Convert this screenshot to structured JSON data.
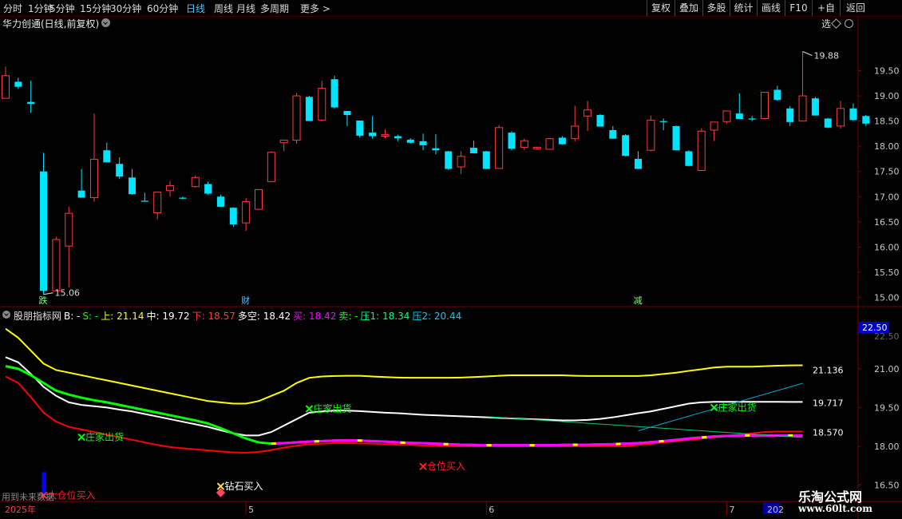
{
  "toolbar": {
    "periods": [
      "分时",
      "1分钟",
      "5分钟",
      "15分钟",
      "30分钟",
      "60分钟",
      "日线",
      "周线",
      "月线",
      "多周期",
      "更多 >"
    ],
    "active_period": "日线",
    "right_buttons": [
      "复权",
      "叠加",
      "多股",
      "统计",
      "画线",
      "F10",
      "+自选",
      "返回"
    ]
  },
  "chart_title": "华力创通(日线,前复权)",
  "colors": {
    "up": "#ff3b3b",
    "down": "#00e5ff",
    "upper_band": "#ffff00",
    "middle_band": "#ffffff",
    "lower_band": "#ff0000",
    "long_short": "#00ff00",
    "buy": "#ff00ff",
    "ma_line": "#00cc66",
    "axis": "#7a0000",
    "tick_text": "#c8c8c8"
  },
  "chart_data": [
    {
      "type": "candlestick",
      "title": "华力创通(日线,前复权)",
      "ylim": [
        14.85,
        20.3
      ],
      "y_ticks": [
        15.0,
        15.5,
        16.0,
        16.5,
        17.0,
        17.5,
        18.0,
        18.5,
        19.0,
        19.5
      ],
      "y_tick_labels": [
        "15.00",
        "15.50",
        "16.00",
        "16.50",
        "17.00",
        "17.50",
        "18.00",
        "18.50",
        "19.00",
        "19.50"
      ],
      "candles": [
        {
          "o": 18.95,
          "h": 19.58,
          "l": 18.95,
          "c": 19.4
        },
        {
          "o": 19.28,
          "h": 19.36,
          "l": 19.14,
          "c": 19.18
        },
        {
          "o": 18.88,
          "h": 19.3,
          "l": 18.66,
          "c": 18.84
        },
        {
          "o": 17.5,
          "h": 17.87,
          "l": 15.06,
          "c": 15.13
        },
        {
          "o": 15.13,
          "h": 16.2,
          "l": 15.13,
          "c": 16.15
        },
        {
          "o": 16.02,
          "h": 16.8,
          "l": 15.2,
          "c": 16.67
        },
        {
          "o": 17.12,
          "h": 17.55,
          "l": 17.1,
          "c": 16.98
        },
        {
          "o": 16.98,
          "h": 18.65,
          "l": 16.9,
          "c": 17.74
        },
        {
          "o": 17.92,
          "h": 18.07,
          "l": 17.72,
          "c": 17.68
        },
        {
          "o": 17.65,
          "h": 17.78,
          "l": 17.35,
          "c": 17.4
        },
        {
          "o": 17.38,
          "h": 17.55,
          "l": 17.04,
          "c": 17.05
        },
        {
          "o": 16.92,
          "h": 17.08,
          "l": 16.9,
          "c": 16.9
        },
        {
          "o": 16.68,
          "h": 17.06,
          "l": 16.55,
          "c": 17.09
        },
        {
          "o": 17.12,
          "h": 17.31,
          "l": 17.0,
          "c": 17.22
        },
        {
          "o": 16.98,
          "h": 17.0,
          "l": 16.95,
          "c": 16.96
        },
        {
          "o": 17.2,
          "h": 17.42,
          "l": 17.18,
          "c": 17.38
        },
        {
          "o": 17.25,
          "h": 17.3,
          "l": 17.04,
          "c": 17.06
        },
        {
          "o": 17.0,
          "h": 17.04,
          "l": 16.82,
          "c": 16.8
        },
        {
          "o": 16.78,
          "h": 16.79,
          "l": 16.4,
          "c": 16.45
        },
        {
          "o": 16.48,
          "h": 16.97,
          "l": 16.32,
          "c": 16.9
        },
        {
          "o": 16.75,
          "h": 17.15,
          "l": 16.74,
          "c": 17.14
        },
        {
          "o": 17.3,
          "h": 17.9,
          "l": 17.3,
          "c": 17.88
        },
        {
          "o": 18.07,
          "h": 18.13,
          "l": 17.9,
          "c": 18.12
        },
        {
          "o": 18.12,
          "h": 19.06,
          "l": 18.05,
          "c": 19.0
        },
        {
          "o": 18.98,
          "h": 19.0,
          "l": 18.52,
          "c": 18.5
        },
        {
          "o": 18.52,
          "h": 19.3,
          "l": 18.5,
          "c": 19.15
        },
        {
          "o": 19.33,
          "h": 19.4,
          "l": 18.75,
          "c": 18.77
        },
        {
          "o": 18.7,
          "h": 18.7,
          "l": 18.4,
          "c": 18.62
        },
        {
          "o": 18.51,
          "h": 18.51,
          "l": 18.17,
          "c": 18.21
        },
        {
          "o": 18.27,
          "h": 18.6,
          "l": 18.15,
          "c": 18.2
        },
        {
          "o": 18.2,
          "h": 18.34,
          "l": 18.16,
          "c": 18.23
        },
        {
          "o": 18.2,
          "h": 18.23,
          "l": 18.1,
          "c": 18.16
        },
        {
          "o": 18.13,
          "h": 18.16,
          "l": 18.05,
          "c": 18.07
        },
        {
          "o": 18.1,
          "h": 18.25,
          "l": 17.92,
          "c": 18.02
        },
        {
          "o": 17.96,
          "h": 18.24,
          "l": 17.84,
          "c": 17.92
        },
        {
          "o": 17.9,
          "h": 17.91,
          "l": 17.53,
          "c": 17.55
        },
        {
          "o": 17.59,
          "h": 17.9,
          "l": 17.45,
          "c": 17.8
        },
        {
          "o": 17.97,
          "h": 18.11,
          "l": 17.87,
          "c": 17.86
        },
        {
          "o": 17.9,
          "h": 17.91,
          "l": 17.55,
          "c": 17.55
        },
        {
          "o": 17.56,
          "h": 18.42,
          "l": 17.55,
          "c": 18.37
        },
        {
          "o": 18.27,
          "h": 18.3,
          "l": 17.92,
          "c": 17.95
        },
        {
          "o": 17.98,
          "h": 18.15,
          "l": 17.92,
          "c": 18.11
        },
        {
          "o": 17.95,
          "h": 17.99,
          "l": 17.94,
          "c": 17.98
        },
        {
          "o": 17.94,
          "h": 18.16,
          "l": 17.93,
          "c": 18.15
        },
        {
          "o": 18.17,
          "h": 18.2,
          "l": 18.03,
          "c": 18.04
        },
        {
          "o": 18.15,
          "h": 18.8,
          "l": 18.1,
          "c": 18.4
        },
        {
          "o": 18.6,
          "h": 18.9,
          "l": 18.3,
          "c": 18.72
        },
        {
          "o": 18.62,
          "h": 18.64,
          "l": 18.41,
          "c": 18.39
        },
        {
          "o": 18.32,
          "h": 18.4,
          "l": 18.15,
          "c": 18.15
        },
        {
          "o": 18.22,
          "h": 18.24,
          "l": 17.8,
          "c": 17.81
        },
        {
          "o": 17.75,
          "h": 17.9,
          "l": 17.55,
          "c": 17.55
        },
        {
          "o": 17.92,
          "h": 18.61,
          "l": 17.9,
          "c": 18.52
        },
        {
          "o": 18.5,
          "h": 18.55,
          "l": 18.32,
          "c": 18.48
        },
        {
          "o": 18.4,
          "h": 18.41,
          "l": 17.95,
          "c": 17.92
        },
        {
          "o": 17.9,
          "h": 17.92,
          "l": 17.6,
          "c": 17.61
        },
        {
          "o": 17.52,
          "h": 18.35,
          "l": 17.52,
          "c": 18.3
        },
        {
          "o": 18.32,
          "h": 18.47,
          "l": 18.1,
          "c": 18.48
        },
        {
          "o": 18.49,
          "h": 18.7,
          "l": 18.45,
          "c": 18.7
        },
        {
          "o": 18.65,
          "h": 19.05,
          "l": 18.55,
          "c": 18.54
        },
        {
          "o": 18.55,
          "h": 18.6,
          "l": 18.5,
          "c": 18.53
        },
        {
          "o": 18.55,
          "h": 19.08,
          "l": 18.55,
          "c": 19.07
        },
        {
          "o": 19.12,
          "h": 19.2,
          "l": 18.9,
          "c": 18.92
        },
        {
          "o": 18.75,
          "h": 18.8,
          "l": 18.4,
          "c": 18.48
        },
        {
          "o": 18.5,
          "h": 19.88,
          "l": 18.5,
          "c": 19.0
        },
        {
          "o": 18.95,
          "h": 18.98,
          "l": 18.65,
          "c": 18.61
        },
        {
          "o": 18.55,
          "h": 18.56,
          "l": 18.36,
          "c": 18.37
        },
        {
          "o": 18.4,
          "h": 18.9,
          "l": 18.35,
          "c": 18.75
        },
        {
          "o": 18.75,
          "h": 18.85,
          "l": 18.5,
          "c": 18.52
        },
        {
          "o": 18.6,
          "h": 18.62,
          "l": 18.4,
          "c": 18.45
        }
      ],
      "high_label": "19.88",
      "low_label": "15.06",
      "event_markers": [
        {
          "index": 3,
          "label": "跌"
        },
        {
          "index": 19,
          "label": "财"
        },
        {
          "index": 50,
          "label": "减"
        }
      ]
    },
    {
      "type": "line",
      "title": "股朋指标网",
      "ylim": [
        16.05,
        22.85
      ],
      "y_ticks": [
        16.5,
        18.0,
        19.5,
        21.0
      ],
      "y_tick_labels": [
        "16.50",
        "18.00",
        "19.50",
        "21.00"
      ],
      "current_value_box": "22.50",
      "top_partial_label": "22.50",
      "legend": [
        {
          "key": "B",
          "text": "B: -"
        },
        {
          "key": "S",
          "text": "S: -"
        },
        {
          "key": "upper",
          "text": "上: 21.14"
        },
        {
          "key": "middle",
          "text": "中: 19.72"
        },
        {
          "key": "lower",
          "text": "下: 18.57"
        },
        {
          "key": "long_short",
          "text": "多空: 18.42"
        },
        {
          "key": "buy",
          "text": "买: 18.42"
        },
        {
          "key": "sell",
          "text": "卖: -"
        },
        {
          "key": "p1",
          "text": "压1: 18.34"
        },
        {
          "key": "p2",
          "text": "压2: 20.44"
        }
      ],
      "series": [
        {
          "key": "upper",
          "values": [
            22.55,
            22.2,
            21.7,
            21.2,
            20.95,
            20.85,
            20.75,
            20.65,
            20.55,
            20.45,
            20.35,
            20.25,
            20.15,
            20.05,
            19.95,
            19.85,
            19.75,
            19.7,
            19.65,
            19.65,
            19.75,
            19.95,
            20.15,
            20.45,
            20.65,
            20.7,
            20.72,
            20.73,
            20.73,
            20.7,
            20.68,
            20.66,
            20.65,
            20.65,
            20.65,
            20.65,
            20.66,
            20.68,
            20.7,
            20.73,
            20.75,
            20.75,
            20.75,
            20.75,
            20.75,
            20.73,
            20.72,
            20.72,
            20.72,
            20.72,
            20.72,
            20.75,
            20.8,
            20.85,
            20.92,
            20.98,
            21.05,
            21.08,
            21.08,
            21.08,
            21.1,
            21.12,
            21.13,
            21.136
          ]
        },
        {
          "key": "middle",
          "values": [
            21.45,
            21.25,
            20.8,
            20.3,
            19.95,
            19.7,
            19.6,
            19.55,
            19.5,
            19.42,
            19.35,
            19.25,
            19.15,
            19.05,
            18.95,
            18.85,
            18.75,
            18.62,
            18.5,
            18.42,
            18.42,
            18.55,
            18.8,
            19.05,
            19.3,
            19.35,
            19.38,
            19.38,
            19.36,
            19.33,
            19.3,
            19.28,
            19.25,
            19.22,
            19.2,
            19.18,
            19.16,
            19.14,
            19.12,
            19.1,
            19.08,
            19.06,
            19.04,
            19.02,
            19.0,
            19.0,
            19.02,
            19.06,
            19.12,
            19.2,
            19.28,
            19.35,
            19.45,
            19.55,
            19.65,
            19.7,
            19.72,
            19.72,
            19.72,
            19.72,
            19.72,
            19.72,
            19.717,
            19.717
          ]
        },
        {
          "key": "lower",
          "values": [
            20.7,
            20.45,
            19.9,
            19.3,
            18.95,
            18.75,
            18.65,
            18.55,
            18.45,
            18.35,
            18.25,
            18.15,
            18.05,
            17.97,
            17.92,
            17.88,
            17.84,
            17.8,
            17.76,
            17.75,
            17.78,
            17.85,
            17.95,
            18.02,
            18.08,
            18.1,
            18.12,
            18.12,
            18.11,
            18.1,
            18.08,
            18.06,
            18.05,
            18.03,
            18.02,
            18.0,
            18.0,
            18.0,
            18.0,
            18.0,
            18.0,
            18.0,
            18.0,
            18.0,
            18.0,
            18.0,
            18.0,
            18.0,
            18.0,
            18.0,
            18.05,
            18.1,
            18.15,
            18.2,
            18.25,
            18.3,
            18.35,
            18.4,
            18.45,
            18.5,
            18.55,
            18.57,
            18.57,
            18.57
          ]
        },
        {
          "key": "long_short",
          "values": [
            21.1,
            21.0,
            20.75,
            20.45,
            20.15,
            20.0,
            19.88,
            19.78,
            19.7,
            19.6,
            19.5,
            19.4,
            19.3,
            19.2,
            19.1,
            19.0,
            18.88,
            18.7,
            18.5,
            18.3,
            18.15,
            18.1,
            18.12,
            18.15,
            18.18,
            18.2,
            18.22,
            18.23,
            18.22,
            18.2,
            18.18,
            18.15,
            18.13,
            18.12,
            18.1,
            18.08,
            18.06,
            18.05,
            18.04,
            18.04,
            18.04,
            18.04,
            18.04,
            18.04,
            18.05,
            18.06,
            18.06,
            18.07,
            18.08,
            18.1,
            18.12,
            18.16,
            18.2,
            18.25,
            18.3,
            18.34,
            18.38,
            18.4,
            18.41,
            18.42,
            18.42,
            18.42,
            18.42,
            18.42
          ]
        }
      ],
      "buy_segment": {
        "from_index": 21,
        "to_index": 63
      },
      "p1_line": {
        "from_index": 38,
        "from_value": 19.15,
        "to_index": 63,
        "to_value": 18.34
      },
      "p2_line": {
        "from_index": 50,
        "from_value": 18.6,
        "to_index": 63,
        "to_value": 20.44
      },
      "right_labels": [
        {
          "series": "upper",
          "text": "21.136"
        },
        {
          "series": "middle",
          "text": "19.717"
        },
        {
          "series": "lower",
          "text": "18.570"
        }
      ],
      "annotations": [
        {
          "index": 6,
          "value": 18.35,
          "text": "庄家出货",
          "color": "#00ff00",
          "mark": "x"
        },
        {
          "index": 24,
          "value": 19.45,
          "text": "庄家出货",
          "color": "#00ff00",
          "mark": "x"
        },
        {
          "index": 56,
          "value": 19.5,
          "text": "庄家出货",
          "color": "#00ff00",
          "mark": "x"
        },
        {
          "index": 33,
          "value": 17.22,
          "text": "仓位买入",
          "color": "#ff2020",
          "mark": "x"
        },
        {
          "index": 17,
          "value": 16.45,
          "text": "钻石买入",
          "color": "#ffffff",
          "mark": "x"
        },
        {
          "index": 3,
          "value": 16.1,
          "text": "大仓位买入",
          "color": "#ff2020",
          "mark": "x"
        }
      ],
      "blue_bar": {
        "index": 3,
        "from_value": 16.1,
        "to_value": 17.0
      }
    }
  ],
  "x_axis": {
    "labels": [
      {
        "index": 0,
        "text": "2025年"
      },
      {
        "index": 19,
        "text": "5"
      },
      {
        "index": 38,
        "text": "6"
      },
      {
        "index": 57,
        "text": "7"
      },
      {
        "index": 60,
        "text": "202"
      }
    ]
  },
  "footer_note": "用到未来数据",
  "watermark": {
    "line1": "乐淘公式网",
    "line2": "www.60lt.com"
  }
}
